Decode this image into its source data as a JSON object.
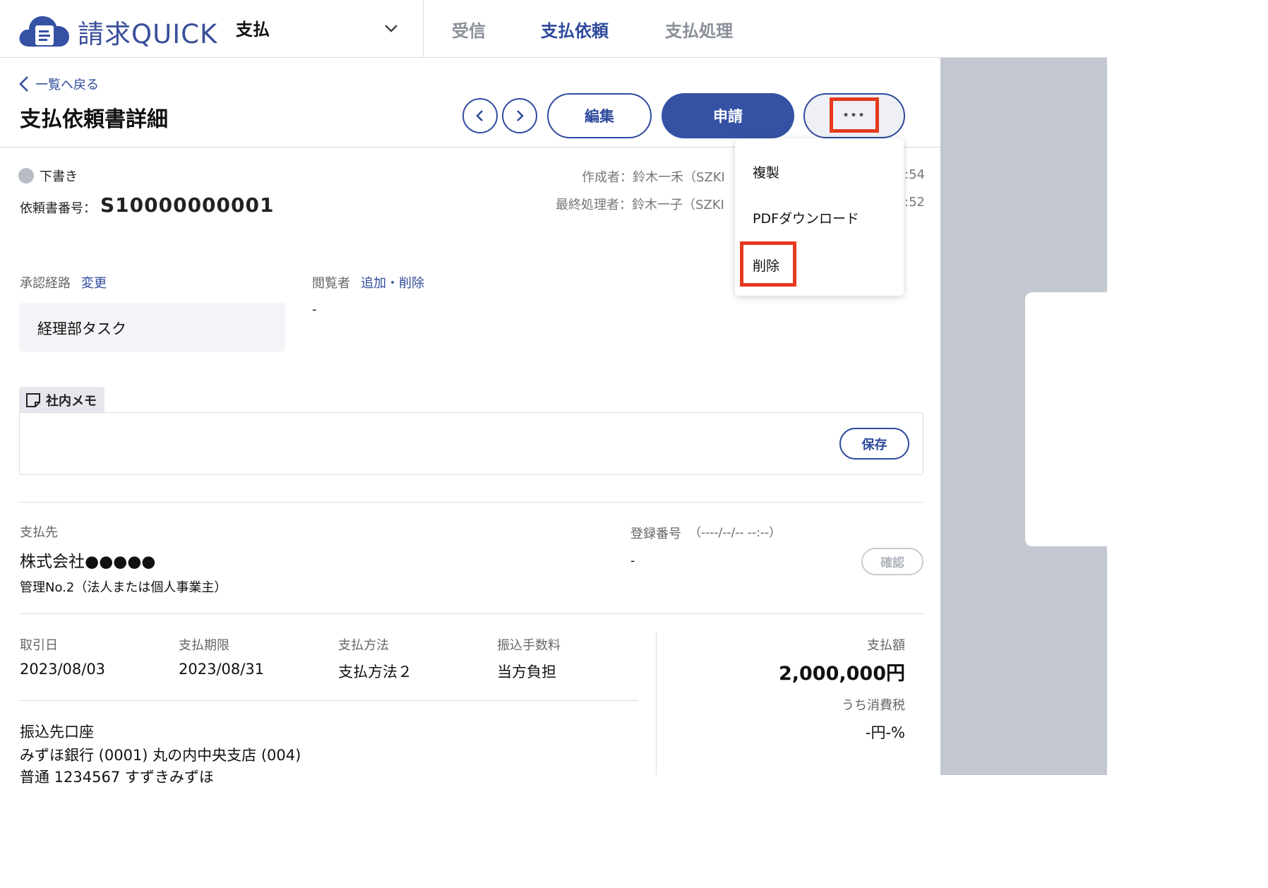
{
  "header": {
    "brand": "請求QUICK",
    "app_select": "支払",
    "nav": [
      "受信",
      "支払依頼",
      "支払処理"
    ]
  },
  "page": {
    "back_link": "一覧へ戻る",
    "title": "支払依頼書詳細",
    "edit_label": "編集",
    "apply_label": "申請",
    "more_label": "•••"
  },
  "menu": {
    "items": [
      "複製",
      "PDFダウンロード",
      "削除"
    ]
  },
  "meta": {
    "status": "下書き",
    "req_label": "依頼書番号：",
    "req_number": "S10000000001",
    "creator": "作成者：鈴木一禾（SZKI",
    "creator_tail": ":54",
    "last_processor": "最終処理者：鈴木一子（SZKI",
    "last_processor_tail": ":52"
  },
  "approval": {
    "label": "承認経路",
    "change_link": "変更",
    "route": "経理部タスク"
  },
  "viewers": {
    "label": "閲覧者",
    "link": "追加・削除",
    "value": "-"
  },
  "memo": {
    "tab": "社内メモ",
    "save": "保存"
  },
  "payee": {
    "label": "支払先",
    "name": "株式会社●●●●●",
    "sub": "管理No.2（法人または個人事業主）",
    "reg_label": "登録番号",
    "reg_date": "（----/--/-- --:--）",
    "reg_value": "-",
    "confirm": "確認"
  },
  "details": {
    "trade_date_label": "取引日",
    "trade_date": "2023/08/03",
    "due_label": "支払期限",
    "due": "2023/08/31",
    "method_label": "支払方法",
    "method": "支払方法２",
    "fee_label": "振込手数料",
    "fee": "当方負担",
    "amount_label": "支払額",
    "amount": "2,000,000円",
    "tax_label": "うち消費税",
    "tax": "-円-%"
  },
  "account": {
    "label": "振込先口座",
    "bank": "みずほ銀行 (0001) 丸の内中央支店 (004)",
    "line2": "普通 1234567 すずきみずほ"
  },
  "colors": {
    "primary": "#2e4a9c",
    "highlight": "#e53a1d",
    "panel": "#c2c7d0"
  }
}
